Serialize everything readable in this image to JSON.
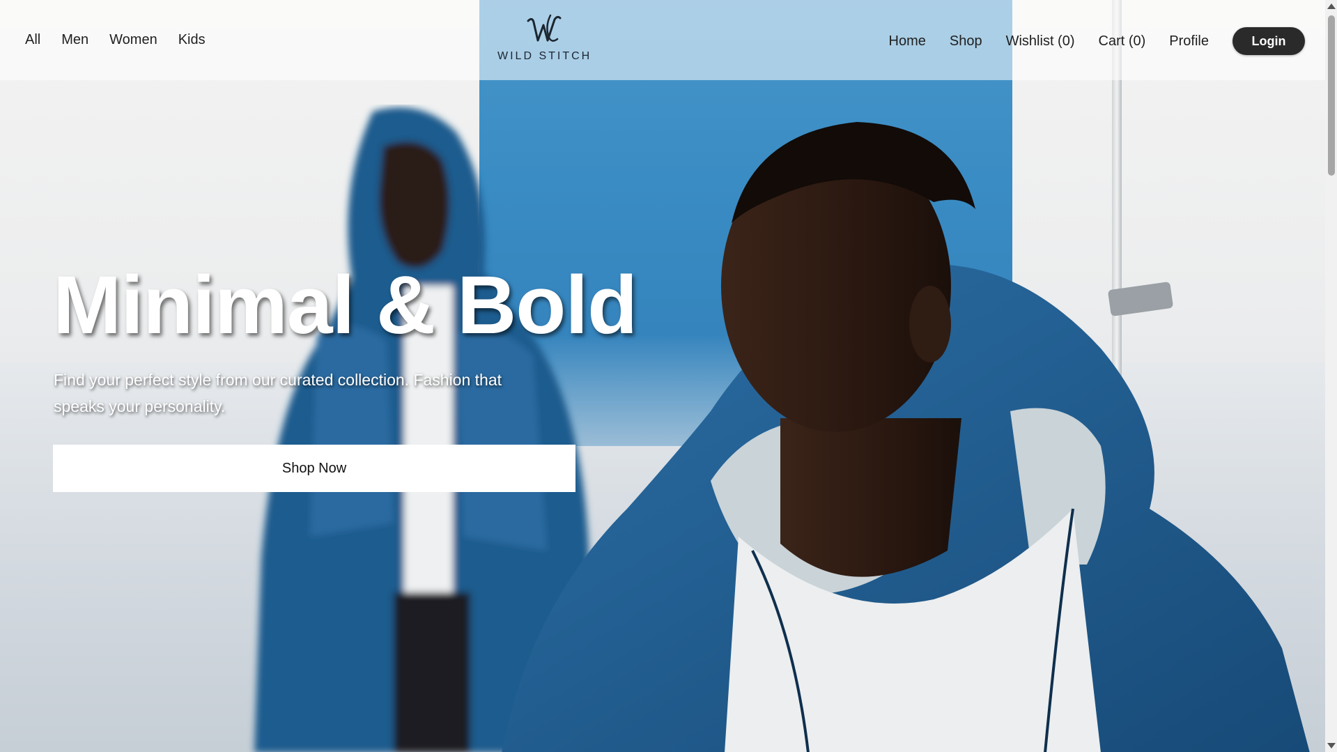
{
  "nav_left": {
    "items": [
      {
        "label": "All"
      },
      {
        "label": "Men"
      },
      {
        "label": "Women"
      },
      {
        "label": "Kids"
      }
    ]
  },
  "logo": {
    "text": "WILD STITCH",
    "icon": "ws-monogram-icon"
  },
  "nav_right": {
    "home": "Home",
    "shop": "Shop",
    "wishlist": "Wishlist (0)",
    "cart": "Cart (0)",
    "profile": "Profile",
    "login": "Login"
  },
  "hero": {
    "title": "Minimal & Bold",
    "subtitle": "Find your perfect style from our curated collection. Fashion that speaks your personality.",
    "cta": "Shop Now"
  },
  "colors": {
    "accent_dark": "#2a2a2a",
    "panel_blue": "#3a8cc4",
    "jacket_blue": "#1f5c8e"
  }
}
